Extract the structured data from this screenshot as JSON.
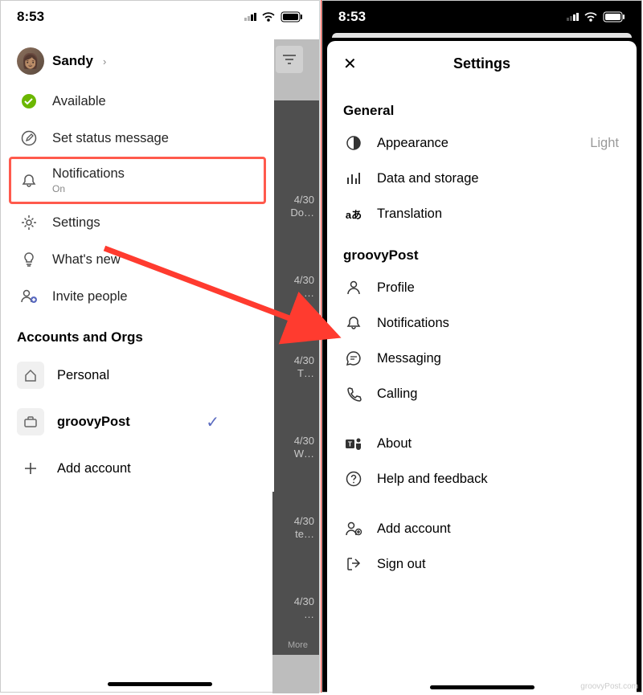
{
  "status": {
    "time": "8:53"
  },
  "left": {
    "profile_name": "Sandy",
    "items": {
      "available": "Available",
      "set_status": "Set status message",
      "notifications": "Notifications",
      "notifications_sub": "On",
      "settings": "Settings",
      "whats_new": "What's new",
      "invite": "Invite people"
    },
    "accounts_header": "Accounts and Orgs",
    "accounts": {
      "personal": "Personal",
      "groovypost": "groovyPost",
      "add": "Add account"
    },
    "bg_snippets": [
      "4/30",
      "Do…",
      "4/30",
      "…",
      "4/30",
      "T…",
      "4/30",
      "W…",
      "4/30",
      "te…",
      "4/30",
      "…",
      "More"
    ]
  },
  "right": {
    "title": "Settings",
    "general_header": "General",
    "items": {
      "appearance": "Appearance",
      "appearance_value": "Light",
      "data": "Data and storage",
      "translation": "Translation"
    },
    "org_header": "groovyPost",
    "org_items": {
      "profile": "Profile",
      "notifications": "Notifications",
      "messaging": "Messaging",
      "calling": "Calling",
      "about": "About",
      "help": "Help and feedback",
      "add_account": "Add account",
      "sign_out": "Sign out"
    }
  },
  "watermark": "groovyPost.com"
}
